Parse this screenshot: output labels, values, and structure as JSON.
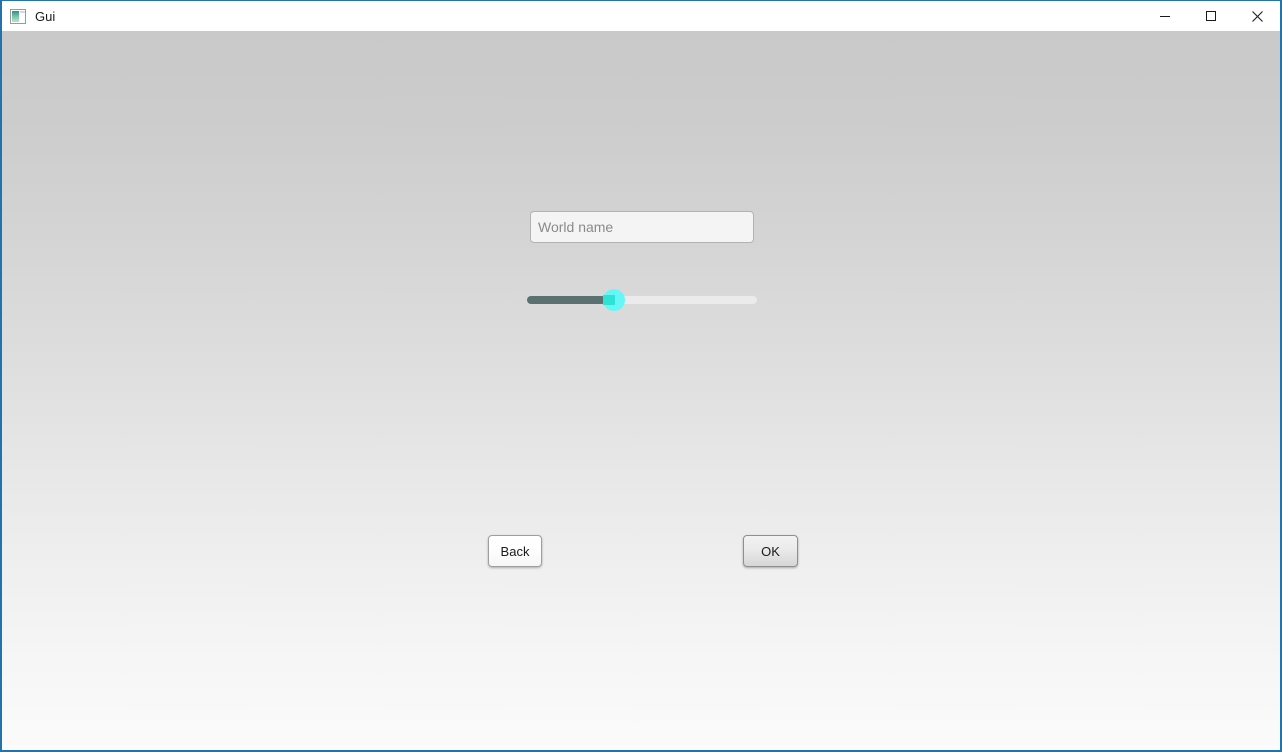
{
  "window": {
    "title": "Gui",
    "icon": "app-window-icon",
    "border_color": "#2272ab",
    "titlebar_background": "#ffffff"
  },
  "window_controls": [
    {
      "name": "minimize",
      "label": "Minimize",
      "glyph": "minimize-icon"
    },
    {
      "name": "maximize",
      "label": "Maximize",
      "glyph": "maximize-icon"
    },
    {
      "name": "close",
      "label": "Close",
      "glyph": "close-icon"
    }
  ],
  "content": {
    "background_top_color": "#c9c9c9",
    "background_bottom_color": "#fbfbfb",
    "world_name_input": {
      "value": "",
      "placeholder": "World name"
    },
    "slider": {
      "value": 38,
      "min": 0,
      "max": 100,
      "track_color": "#ebebeb",
      "fill_color": "#5b7071",
      "thumb_color": "#65f7f7",
      "thumb_inner_color": "#2fe2d6"
    },
    "buttons": {
      "back_label": "Back",
      "ok_label": "OK"
    }
  }
}
